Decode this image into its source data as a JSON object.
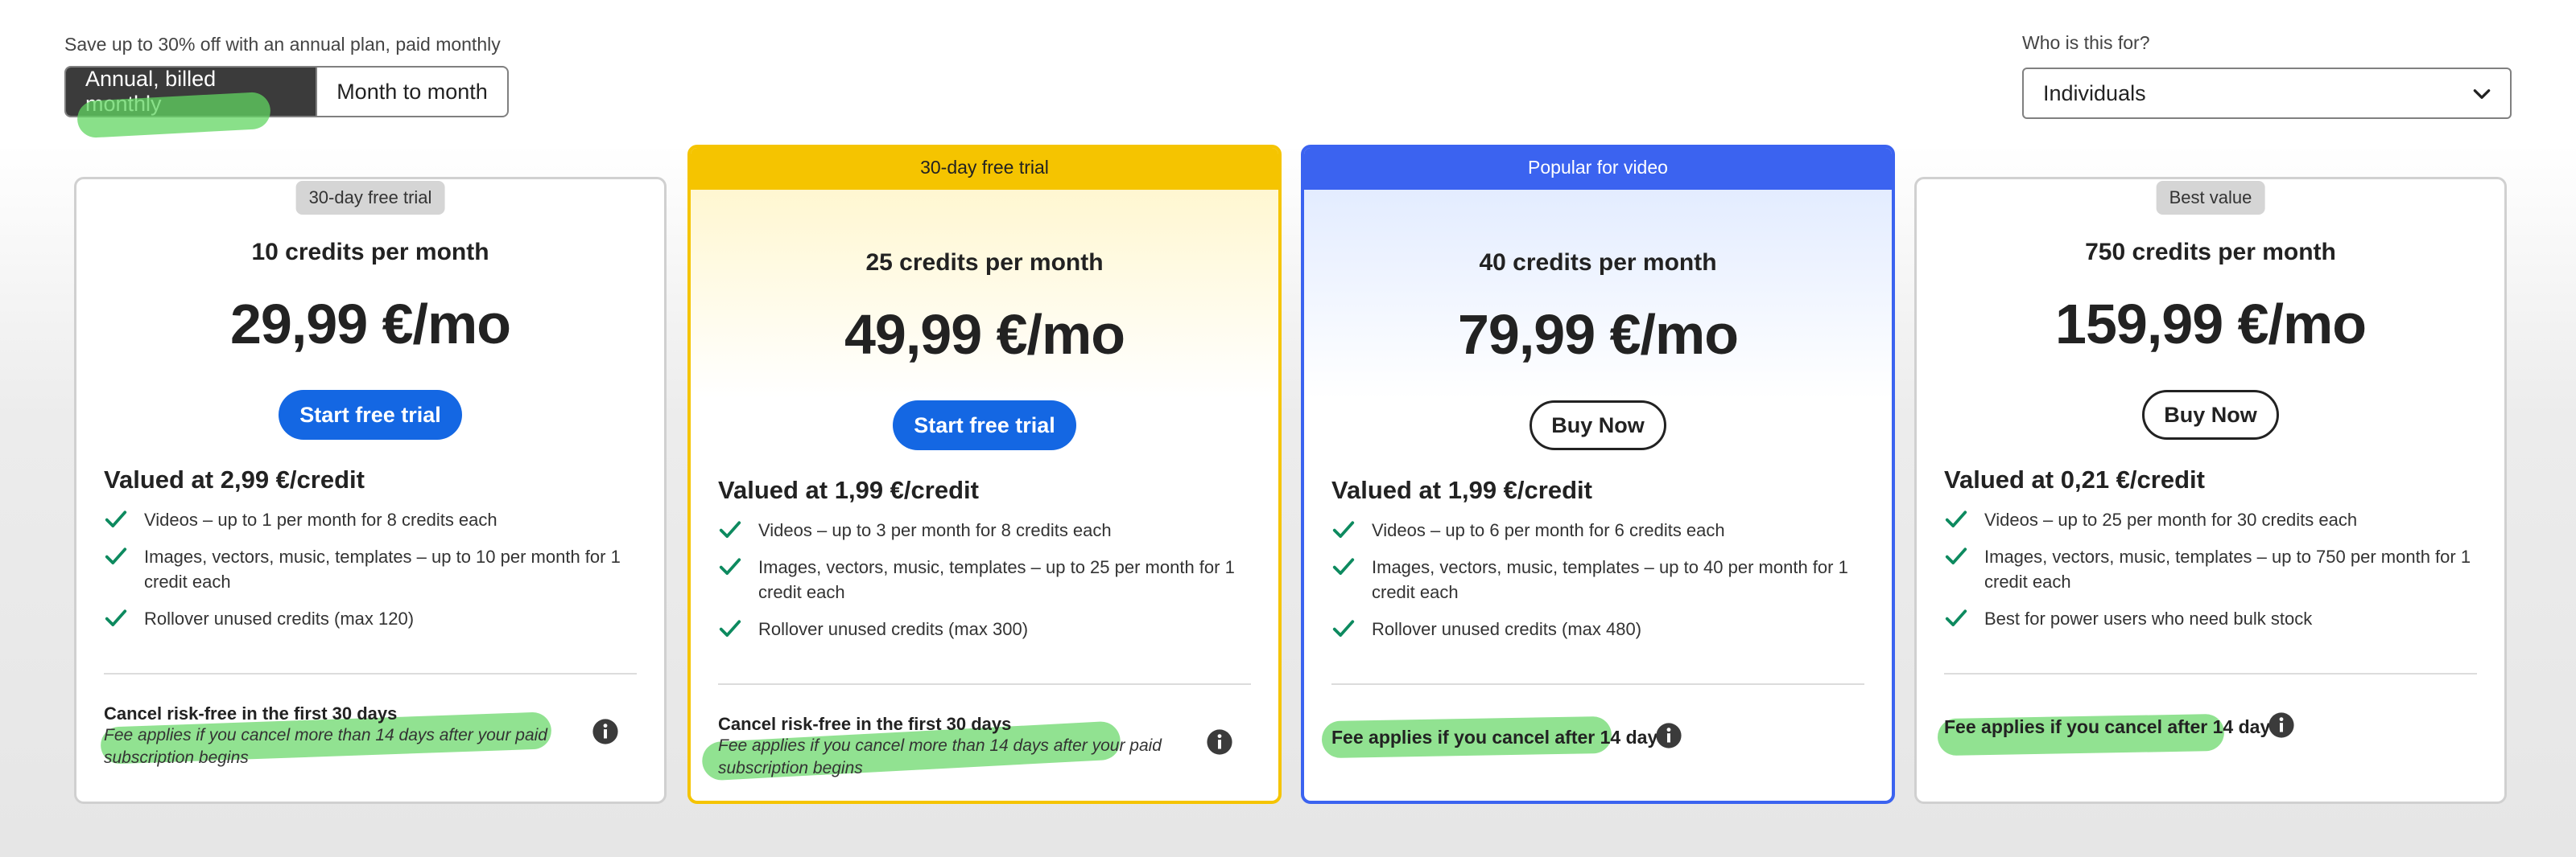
{
  "billing": {
    "save_text": "Save up to 30% off with an annual plan, paid monthly",
    "options": [
      "Annual, billed monthly",
      "Month to month"
    ],
    "selected": "Annual, billed monthly"
  },
  "audience": {
    "label": "Who is this for?",
    "selected": "Individuals"
  },
  "plans": [
    {
      "badge": "30-day free trial",
      "credits": "10 credits per month",
      "price": "29,99 €/mo",
      "cta": "Start free trial",
      "valued": "Valued at 2,99 €/credit",
      "features": [
        "Videos – up to 1 per month for 8 credits each",
        "Images, vectors, music, templates – up to 10 per month for 1 credit each",
        "Rollover unused credits (max 120)"
      ],
      "footer_title": "Cancel risk-free in the first 30 days",
      "footer_note": "Fee applies if you cancel more than 14 days after your paid subscription begins"
    },
    {
      "banner": "30-day free trial",
      "credits": "25 credits per month",
      "price": "49,99 €/mo",
      "cta": "Start free trial",
      "valued": "Valued at 1,99 €/credit",
      "features": [
        "Videos – up to 3 per month for 8 credits each",
        "Images, vectors, music, templates – up to 25 per month for 1 credit each",
        "Rollover unused credits (max 300)"
      ],
      "footer_title": "Cancel risk-free in the first 30 days",
      "footer_note": "Fee applies if you cancel more than 14 days after your paid subscription begins"
    },
    {
      "banner": "Popular for video",
      "credits": "40 credits per month",
      "price": "79,99 €/mo",
      "cta": "Buy Now",
      "valued": "Valued at 1,99 €/credit",
      "features": [
        "Videos – up to 6 per month for 6 credits each",
        "Images, vectors, music, templates – up to 40 per month for 1 credit each",
        "Rollover unused credits (max 480)"
      ],
      "footer_fee": "Fee applies if you cancel after 14 days"
    },
    {
      "badge": "Best value",
      "credits": "750 credits per month",
      "price": "159,99 €/mo",
      "cta": "Buy Now",
      "valued": "Valued at 0,21 €/credit",
      "features": [
        "Videos – up to 25 per month for 30 credits each",
        "Images, vectors, music, templates – up to 750 per month for 1 credit each",
        "Best for power users who need bulk stock"
      ],
      "footer_fee": "Fee applies if you cancel after 14 days"
    }
  ],
  "colors": {
    "primary_button": "#1467e3",
    "yellow_accent": "#f5c400",
    "blue_accent": "#3b63f0",
    "check": "#0d8a5f",
    "highlighter": "#62d662"
  },
  "icons": {
    "check": "check-icon",
    "info": "info-icon",
    "dropdown": "chevron-down-icon"
  }
}
